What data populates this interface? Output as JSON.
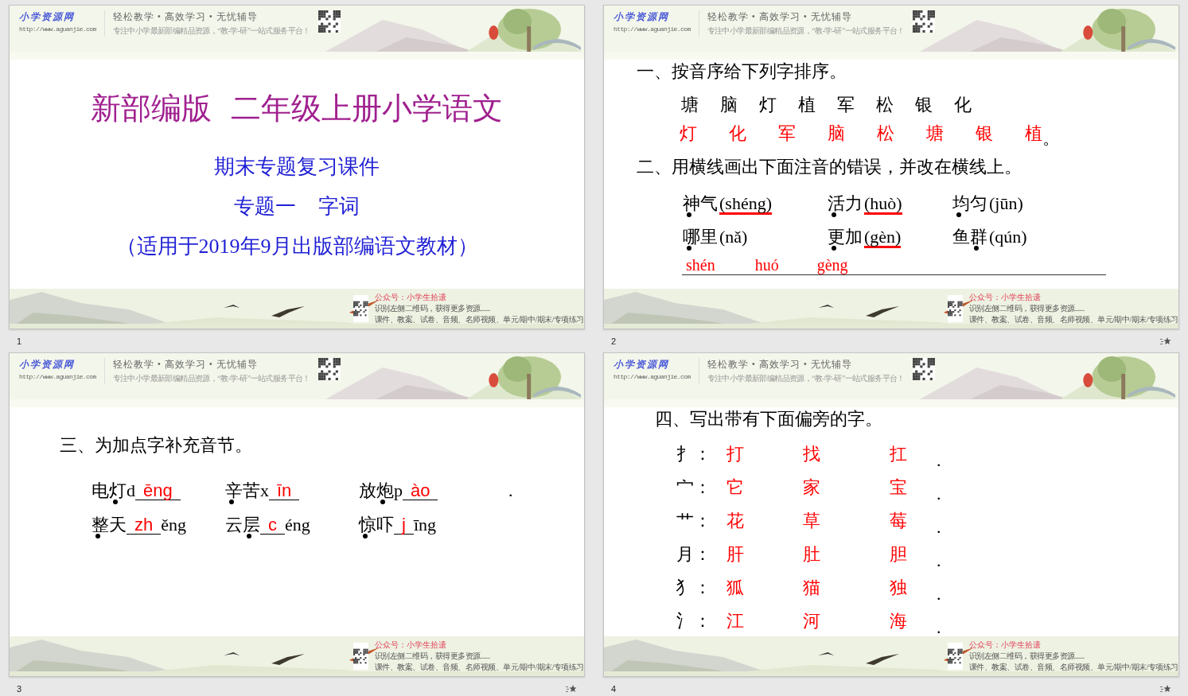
{
  "slides": [
    {
      "number": "1",
      "transition": false,
      "kind": "title",
      "header": {
        "logo": "小学资源网",
        "url": "http://www.aguanjie.com",
        "slogan": "轻松教学 • 高效学习 • 无忧辅导",
        "tagline": "专注中小学最新部编精品资源，“教-学-研”一站式服务平台！"
      },
      "footer": {
        "account": "公众号：小学生拾遗",
        "line1": "识别左侧二维码，获得更多资源......",
        "line2": "课件、教案、试卷、音频、名师视频、单元/期中/期末/专项练习"
      },
      "title": [
        "新部编版",
        "二年级上册小学语文"
      ],
      "subtitle": "期末专题复习课件",
      "topic": [
        "专题一",
        "字词"
      ],
      "note": "（适用于2019年9月出版部编语文教材）"
    },
    {
      "number": "2",
      "transition": true,
      "kind": "exercises_1_2",
      "header": {
        "logo": "小学资源网",
        "url": "http://www.aguanjie.com",
        "slogan": "轻松教学 • 高效学习 • 无忧辅导",
        "tagline": "专注中小学最新部编精品资源，“教-学-研”一站式服务平台！"
      },
      "footer": {
        "account": "公众号：小学生拾遗",
        "line1": "识别左侧二维码，获得更多资源......",
        "line2": "课件、教案、试卷、音频、名师视频、单元/期中/期末/专项练习"
      },
      "q1": {
        "heading": "一、按音序给下列字排序。",
        "chars": [
          "塘",
          "脑",
          "灯",
          "植",
          "军",
          "松",
          "银",
          "化"
        ],
        "answers": [
          "灯",
          "化",
          "军",
          "脑",
          "松",
          "塘",
          "银",
          "植"
        ],
        "end": "。"
      },
      "q2": {
        "heading": "二、用横线画出下面注音的错误，并改在横线上。",
        "items": [
          {
            "word": [
              {
                "char": "神",
                "dotted": true
              },
              {
                "char": "气",
                "dotted": false
              }
            ],
            "pinyin": "(shéng)",
            "underlined": true
          },
          {
            "word": [
              {
                "char": "活",
                "dotted": true
              },
              {
                "char": "力",
                "dotted": false
              }
            ],
            "pinyin": "(huò)",
            "underlined": true
          },
          {
            "word": [
              {
                "char": "均",
                "dotted": true
              },
              {
                "char": "匀",
                "dotted": false
              }
            ],
            "pinyin": "(jūn)",
            "underlined": false
          },
          {
            "word": [
              {
                "char": "哪",
                "dotted": true
              },
              {
                "char": "里",
                "dotted": false
              }
            ],
            "pinyin": "(nǎ)",
            "underlined": false
          },
          {
            "word": [
              {
                "char": "更",
                "dotted": true
              },
              {
                "char": "加",
                "dotted": false
              }
            ],
            "pinyin": "(gèn)",
            "underlined": true
          },
          {
            "word": [
              {
                "char": "鱼",
                "dotted": false
              },
              {
                "char": "群",
                "dotted": true
              }
            ],
            "pinyin": "(qún)",
            "underlined": false
          }
        ],
        "answers": [
          "shén",
          "huó",
          "gèng"
        ]
      }
    },
    {
      "number": "3",
      "transition": true,
      "kind": "exercise_3",
      "header": {
        "logo": "小学资源网",
        "url": "http://www.aguanjie.com",
        "slogan": "轻松教学 • 高效学习 • 无忧辅导",
        "tagline": "专注中小学最新部编精品资源，“教-学-研”一站式服务平台！"
      },
      "footer": {
        "account": "公众号：小学生拾遗",
        "line1": "识别左侧二维码，获得更多资源......",
        "line2": "课件、教案、试卷、音频、名师视频、单元/期中/期末/专项练习"
      },
      "q3": {
        "heading": "三、为加点字补充音节。",
        "rows": [
          {
            "items": [
              {
                "word": [
                  {
                    "char": "电",
                    "dotted": false
                  },
                  {
                    "char": "灯",
                    "dotted": true
                  }
                ],
                "initial": "d",
                "answer": "ēng"
              },
              {
                "word": [
                  {
                    "char": "辛",
                    "dotted": true
                  },
                  {
                    "char": "苦",
                    "dotted": false
                  }
                ],
                "initial": "x",
                "answer": "īn"
              },
              {
                "word": [
                  {
                    "char": "放",
                    "dotted": false
                  },
                  {
                    "char": "炮",
                    "dotted": true
                  }
                ],
                "initial": "p",
                "answer": "ào"
              }
            ],
            "end": "."
          },
          {
            "items": [
              {
                "word": [
                  {
                    "char": "整",
                    "dotted": true
                  },
                  {
                    "char": "天",
                    "dotted": false
                  }
                ],
                "answer": "zh",
                "final": "ěng"
              },
              {
                "word": [
                  {
                    "char": "云",
                    "dotted": false
                  },
                  {
                    "char": "层",
                    "dotted": true
                  }
                ],
                "answer": "c",
                "final": "éng"
              },
              {
                "word": [
                  {
                    "char": "惊",
                    "dotted": true
                  },
                  {
                    "char": "吓",
                    "dotted": false
                  }
                ],
                "answer": "j",
                "final": "īng"
              }
            ]
          }
        ]
      }
    },
    {
      "number": "4",
      "transition": true,
      "kind": "exercise_4",
      "header": {
        "logo": "小学资源网",
        "url": "http://www.aguanjie.com",
        "slogan": "轻松教学 • 高效学习 • 无忧辅导",
        "tagline": "专注中小学最新部编精品资源，“教-学-研”一站式服务平台！"
      },
      "footer": {
        "account": "公众号：小学生拾遗",
        "line1": "识别左侧二维码，获得更多资源......",
        "line2": "课件、教案、试卷、音频、名师视频、单元/期中/期末/专项练习"
      },
      "q4": {
        "heading": "四、写出带有下面偏旁的字。",
        "rows": [
          {
            "radical": "扌：",
            "answers": [
              "打",
              "找",
              "扛"
            ],
            "end": "."
          },
          {
            "radical": "宀：",
            "answers": [
              "它",
              "家",
              "宝"
            ],
            "end": "."
          },
          {
            "radical": "艹：",
            "answers": [
              "花",
              "草",
              "莓"
            ],
            "end": "."
          },
          {
            "radical": "月：",
            "answers": [
              "肝",
              "肚",
              "胆"
            ],
            "end": "."
          },
          {
            "radical": "犭：",
            "answers": [
              "狐",
              "猫",
              "独"
            ],
            "end": "."
          },
          {
            "radical": "氵：",
            "answers": [
              "江",
              "河",
              "海"
            ],
            "end": "."
          }
        ]
      }
    }
  ]
}
